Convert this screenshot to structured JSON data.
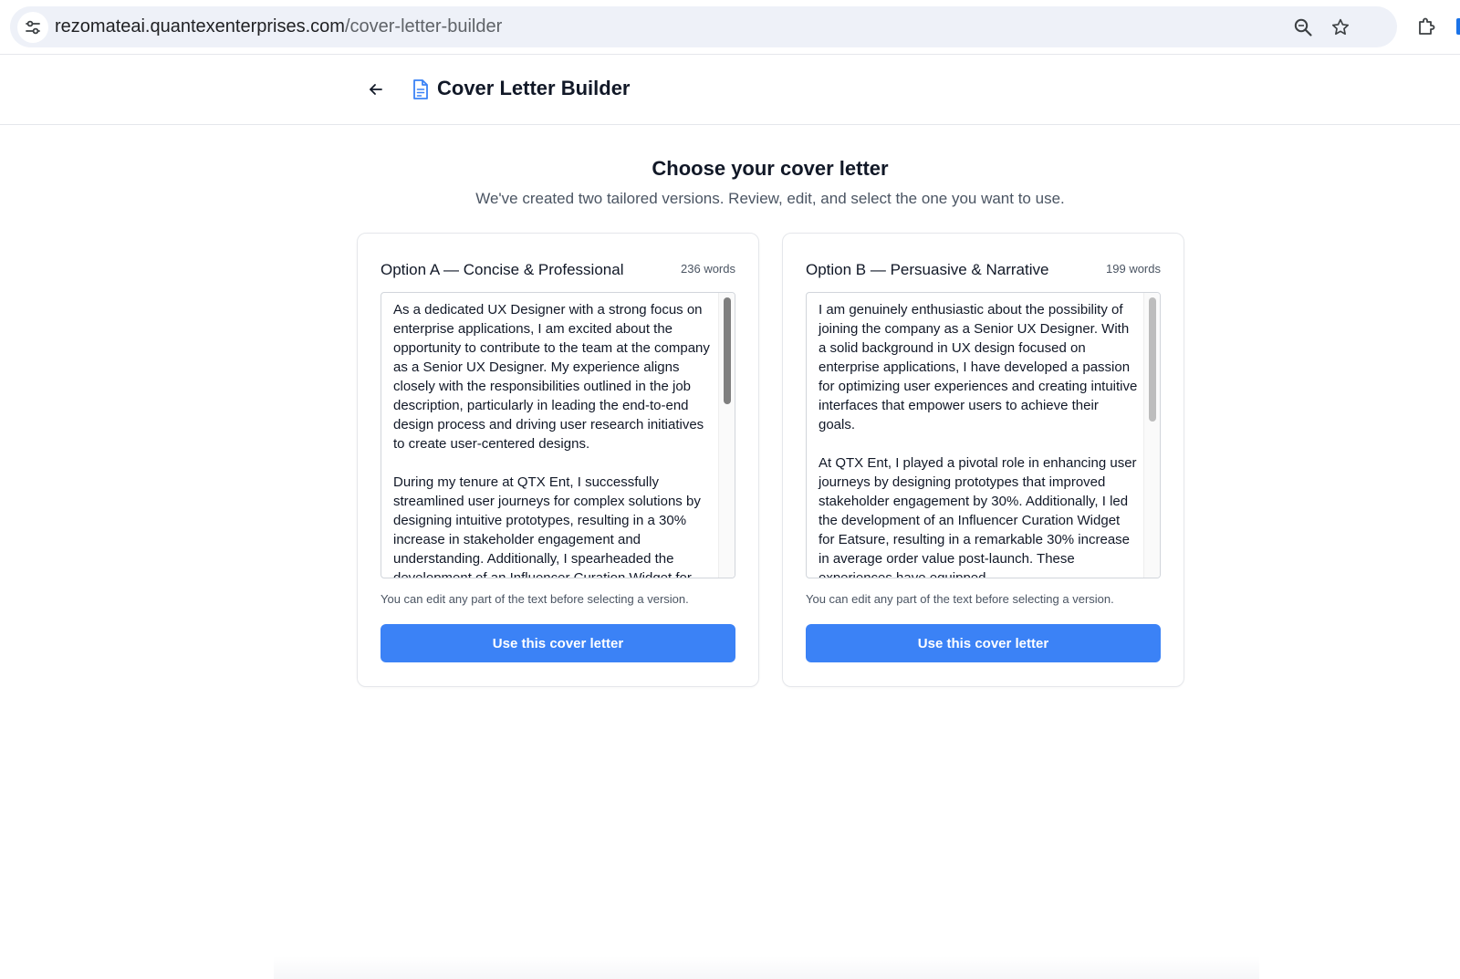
{
  "browser": {
    "url_host": "rezomateai.quantexenterprises.com",
    "url_path": "/cover-letter-builder"
  },
  "header": {
    "title": "Cover Letter Builder"
  },
  "intro": {
    "title": "Choose your cover letter",
    "subtitle": "We've created two tailored versions. Review, edit, and select the one you want to use."
  },
  "options": [
    {
      "title": "Option A — Concise & Professional",
      "word_count": "236 words",
      "paragraphs": [
        "As a dedicated UX Designer with a strong focus on enterprise applications, I am excited about the opportunity to contribute to the team at the company as a Senior UX Designer. My experience aligns closely with the responsibilities outlined in the job description, particularly in leading the end-to-end design process and driving user research initiatives to create user-centered designs.",
        "During my tenure at QTX Ent, I successfully streamlined user journeys for complex solutions by designing intuitive prototypes, resulting in a 30% increase in stakeholder engagement and understanding. Additionally, I spearheaded the development of an Influencer Curation Widget for"
      ],
      "helper": "You can edit any part of the text before selecting a version.",
      "button_label": "Use this cover letter",
      "scroll_fraction": 0.0
    },
    {
      "title": "Option B — Persuasive & Narrative",
      "word_count": "199 words",
      "paragraphs": [
        "I am genuinely enthusiastic about the possibility of joining the company as a Senior UX Designer. With a solid background in UX design focused on enterprise applications, I have developed a passion for optimizing user experiences and creating intuitive interfaces that empower users to achieve their goals.",
        "At QTX Ent, I played a pivotal role in enhancing user journeys by designing prototypes that improved stakeholder engagement by 30%. Additionally, I led the development of an Influencer Curation Widget for Eatsure, resulting in a remarkable 30% increase in average order value post-launch. These experiences have equipped"
      ],
      "helper": "You can edit any part of the text before selecting a version.",
      "button_label": "Use this cover letter",
      "scroll_fraction": 0.0
    }
  ],
  "colors": {
    "accent": "#3b82f6",
    "doc_icon": "#3b82f6",
    "border": "#e5e7eb"
  }
}
